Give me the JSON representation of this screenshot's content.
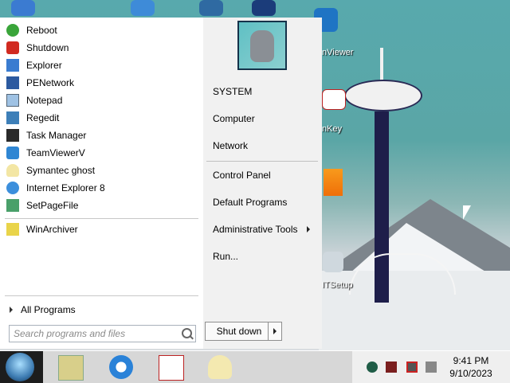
{
  "start_menu": {
    "programs": [
      {
        "label": "Reboot",
        "icon": "reboot-icon"
      },
      {
        "label": "Shutdown",
        "icon": "shutdown-icon"
      },
      {
        "label": "Explorer",
        "icon": "explorer-icon"
      },
      {
        "label": "PENetwork",
        "icon": "network-icon"
      },
      {
        "label": "Notepad",
        "icon": "notepad-icon"
      },
      {
        "label": "Regedit",
        "icon": "regedit-icon"
      },
      {
        "label": "Task Manager",
        "icon": "task-manager-icon"
      },
      {
        "label": "TeamViewerV",
        "icon": "teamviewer-icon"
      },
      {
        "label": "Symantec ghost",
        "icon": "ghost-icon"
      },
      {
        "label": "Internet Explorer 8",
        "icon": "internet-explorer-icon"
      },
      {
        "label": "SetPageFile",
        "icon": "setpagefile-icon"
      }
    ],
    "pinned": [
      {
        "label": "WinArchiver",
        "icon": "winarchiver-icon"
      }
    ],
    "all_programs": "All Programs",
    "search_placeholder": "Search programs and files",
    "right": {
      "user": "SYSTEM",
      "computer": "Computer",
      "network": "Network",
      "control_panel": "Control Panel",
      "default_programs": "Default Programs",
      "admin_tools": "Administrative Tools",
      "run": "Run..."
    },
    "shutdown_label": "Shut down"
  },
  "desktop": {
    "labels": {
      "teamviewer": "nViewer",
      "key": "nKey",
      "setup": "ITSetup"
    }
  },
  "taskbar": {
    "time": "9:41 PM",
    "date": "9/10/2023"
  }
}
